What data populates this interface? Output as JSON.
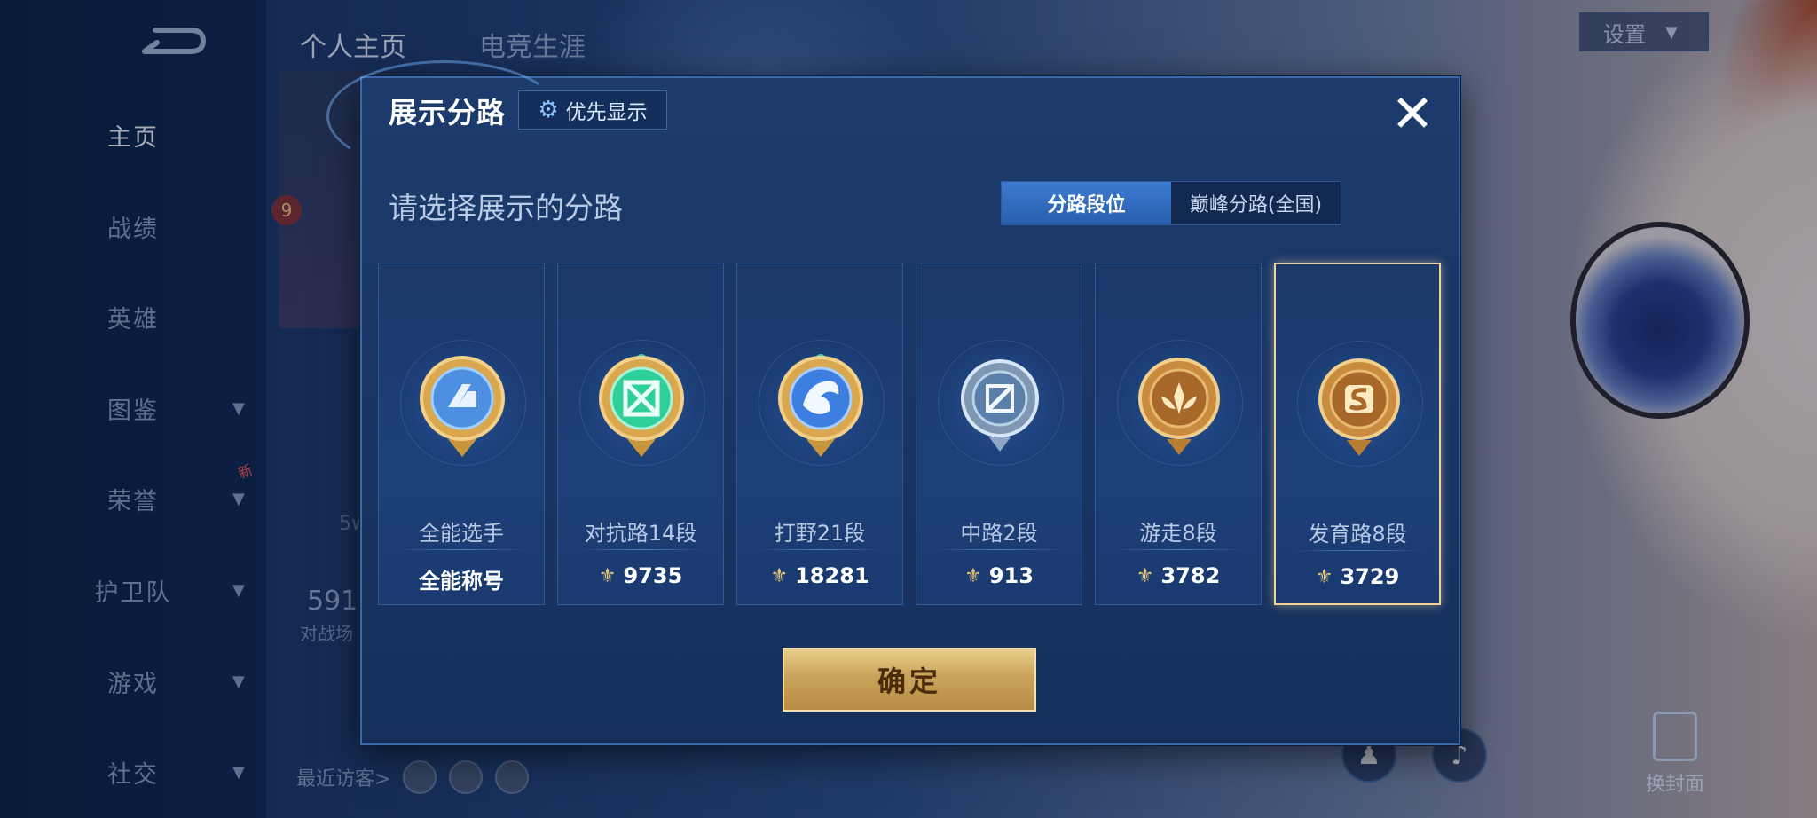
{
  "sidebar": {
    "items": [
      {
        "label": "主页",
        "active": true
      },
      {
        "label": "战绩"
      },
      {
        "label": "英雄"
      },
      {
        "label": "图鉴",
        "has_chevron": true
      },
      {
        "label": "荣誉",
        "has_chevron": true,
        "badge": "新"
      },
      {
        "label": "护卫队",
        "has_chevron": true
      },
      {
        "label": "游戏",
        "has_chevron": true
      },
      {
        "label": "社交",
        "has_chevron": true
      }
    ]
  },
  "header": {
    "tabs": [
      "个人主页",
      "电竞生涯"
    ],
    "settings_label": "设置"
  },
  "background": {
    "level": "9",
    "stat_partial": "591",
    "stat_sub": "对战场",
    "fragment": "5w",
    "recent_visitors_label": "最近访客>",
    "change_cover_label": "换封面"
  },
  "modal": {
    "title": "展示分路",
    "priority_label": "优先显示",
    "subtitle": "请选择展示的分路",
    "mode_tabs": [
      {
        "label": "分路段位",
        "active": true
      },
      {
        "label": "巅峰分路(全国)",
        "active": false
      }
    ],
    "cards": [
      {
        "label": "全能选手",
        "value": "全能称号",
        "show_points_icon": false,
        "emblem": "all-round-emblem",
        "color": "#4d8fe0",
        "selected": false
      },
      {
        "label": "对抗路14段",
        "value": "9735",
        "show_points_icon": true,
        "emblem": "clash-lane-emblem",
        "color": "#2fcf9a",
        "selected": false
      },
      {
        "label": "打野21段",
        "value": "18281",
        "show_points_icon": true,
        "emblem": "jungle-emblem",
        "color": "#3d7fe0",
        "selected": false
      },
      {
        "label": "中路2段",
        "value": "913",
        "show_points_icon": true,
        "emblem": "mid-lane-emblem",
        "color": "#9fb9d6",
        "selected": false
      },
      {
        "label": "游走8段",
        "value": "3782",
        "show_points_icon": true,
        "emblem": "roam-emblem",
        "color": "#d89a48",
        "selected": false
      },
      {
        "label": "发育路8段",
        "value": "3729",
        "show_points_icon": true,
        "emblem": "farm-lane-emblem",
        "color": "#d89a48",
        "selected": true
      }
    ],
    "confirm_label": "确定",
    "accent_gold": "#f3d39c"
  }
}
